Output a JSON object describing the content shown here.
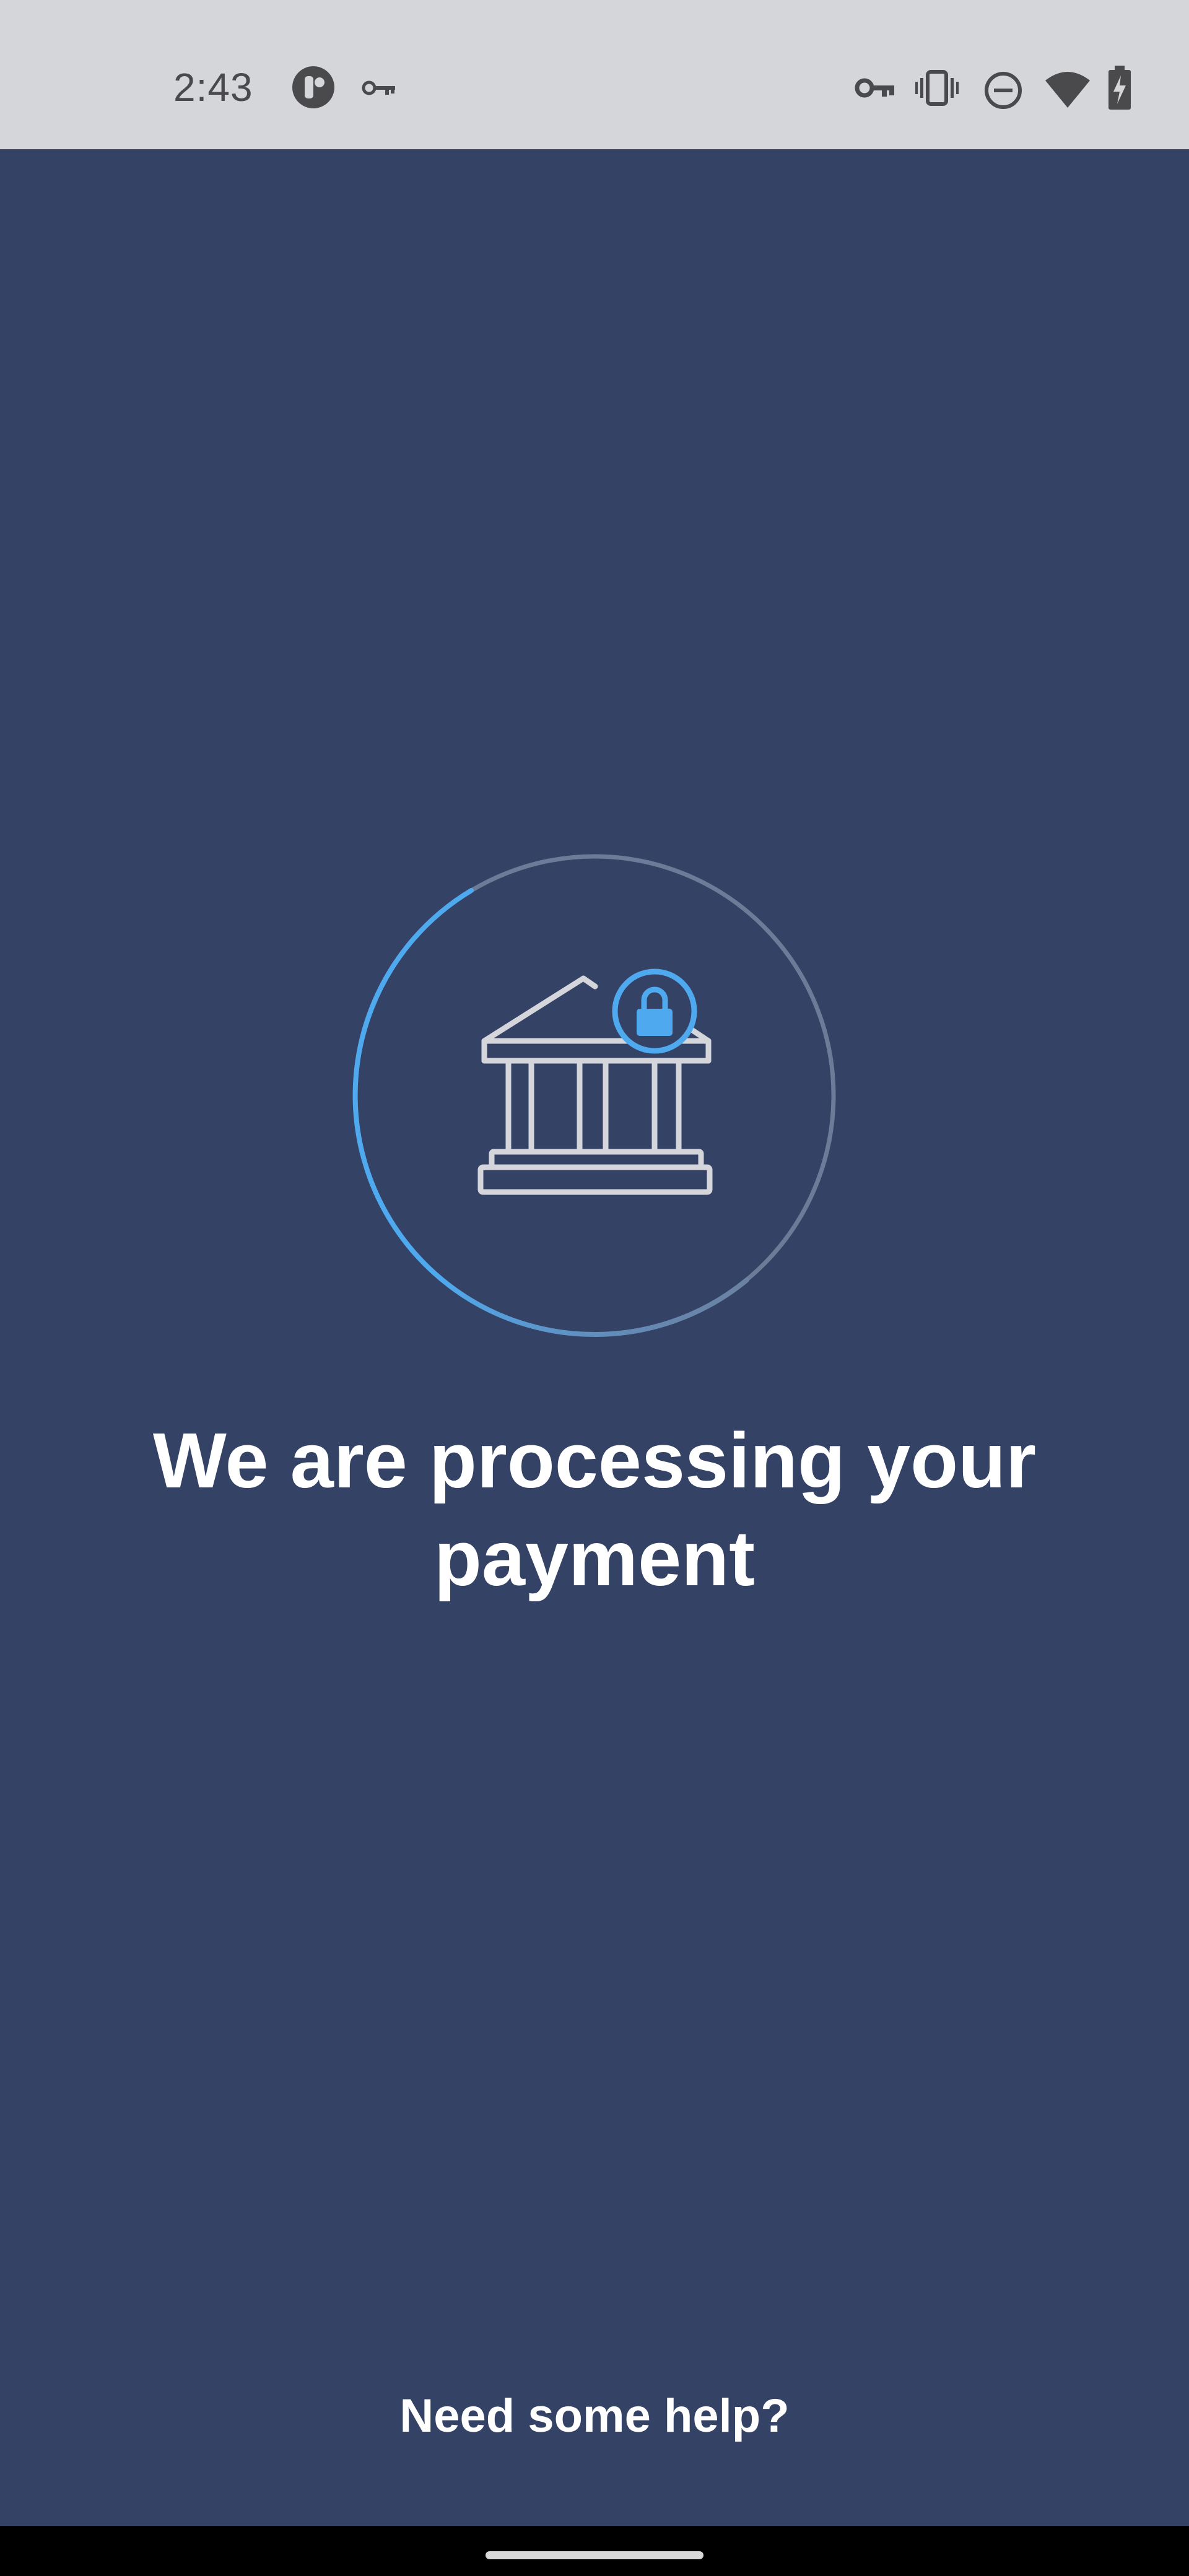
{
  "status_bar": {
    "time": "2:43",
    "left_icons": [
      "app-notification-icon",
      "key-icon"
    ],
    "right_icons": [
      "vpn-key-icon",
      "vibrate-icon",
      "do-not-disturb-icon",
      "wifi-icon",
      "battery-charging-icon"
    ]
  },
  "main": {
    "illustration": {
      "icon": "bank-lock-icon",
      "ring_color_active": "#4fa9ee",
      "ring_color_track": "#6e7b98"
    },
    "headline": "We are processing your payment",
    "help_link": "Need some help?"
  },
  "colors": {
    "background": "#344266",
    "status_bar": "#d5d6da",
    "accent": "#4fa9ee",
    "text": "#ffffff"
  }
}
